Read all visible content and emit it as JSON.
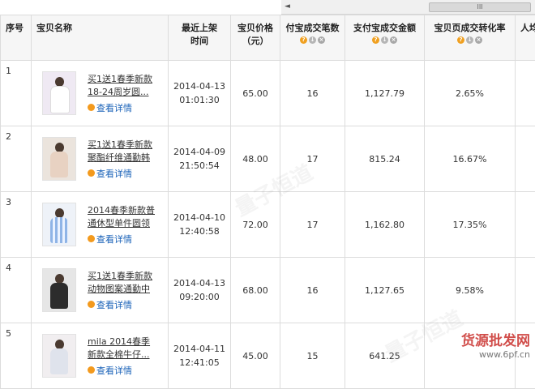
{
  "scrollbar": {
    "arrow": "◄",
    "thumb_grip": "III"
  },
  "columns": {
    "index": "序号",
    "name": "宝贝名称",
    "listed_line1": "最近上架",
    "listed_line2": "时间",
    "price_line1": "宝贝价格",
    "price_line2": "（元）",
    "alipay_count": "付宝成交笔数",
    "alipay_amount": "支付宝成交金额",
    "conversion": "宝贝页成交转化率",
    "extra": "人均"
  },
  "header_tools": {
    "help": "?",
    "sort": "↓",
    "remove": "×"
  },
  "detail_label": "查看详情",
  "rows": [
    {
      "index": "1",
      "name_line1": "买1送1春季新款",
      "name_line2": "18-24周岁圆...",
      "date": "2014-04-13",
      "time": "01:01:30",
      "price": "65.00",
      "count": "16",
      "amount": "1,127.79",
      "conversion": "2.65%"
    },
    {
      "index": "2",
      "name_line1": "买1送1春季新款",
      "name_line2": "聚酯纤维通勤韩版...",
      "date": "2014-04-09",
      "time": "21:50:54",
      "price": "48.00",
      "count": "17",
      "amount": "815.24",
      "conversion": "16.67%"
    },
    {
      "index": "3",
      "name_line1": "2014春季新款普",
      "name_line2": "通休型单件圆领短...",
      "date": "2014-04-10",
      "time": "12:40:58",
      "price": "72.00",
      "count": "17",
      "amount": "1,162.80",
      "conversion": "17.35%"
    },
    {
      "index": "4",
      "name_line1": "买1送1春季新款",
      "name_line2": "动物图案通勤中长...",
      "date": "2014-04-13",
      "time": "09:20:00",
      "price": "68.00",
      "count": "16",
      "amount": "1,127.65",
      "conversion": "9.58%"
    },
    {
      "index": "5",
      "name_line1": "mila 2014春季",
      "name_line2": "新款全棉牛仔...",
      "date": "2014-04-11",
      "time": "12:41:05",
      "price": "45.00",
      "count": "15",
      "amount": "641.25",
      "conversion": ""
    }
  ],
  "watermark": {
    "faint": "量子恒道",
    "brand": "货源批发网",
    "site": "www.6pf.cn"
  }
}
